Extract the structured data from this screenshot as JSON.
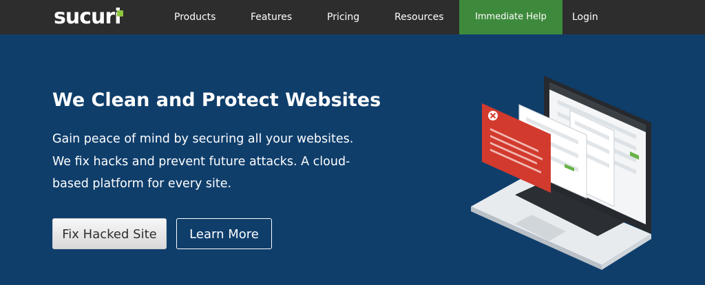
{
  "header": {
    "logo_text": "sucuri",
    "nav": {
      "products": "Products",
      "features": "Features",
      "pricing": "Pricing",
      "resources": "Resources",
      "help": "Immediate Help",
      "login": "Login"
    }
  },
  "hero": {
    "title": "We Clean and Protect Websites",
    "text": "Gain peace of mind by securing all your websites. We fix hacks and prevent future attacks. A cloud-based platform for every site.",
    "buttons": {
      "fix": "Fix Hacked Site",
      "learn": "Learn More"
    }
  },
  "colors": {
    "background": "#0f3e6b",
    "topbar": "#2d2d2d",
    "help_button": "#3e8a3c",
    "logo_accent": "#8dc63f",
    "alert_card": "#d23a2e"
  },
  "icons": {
    "alert": "close-icon"
  }
}
